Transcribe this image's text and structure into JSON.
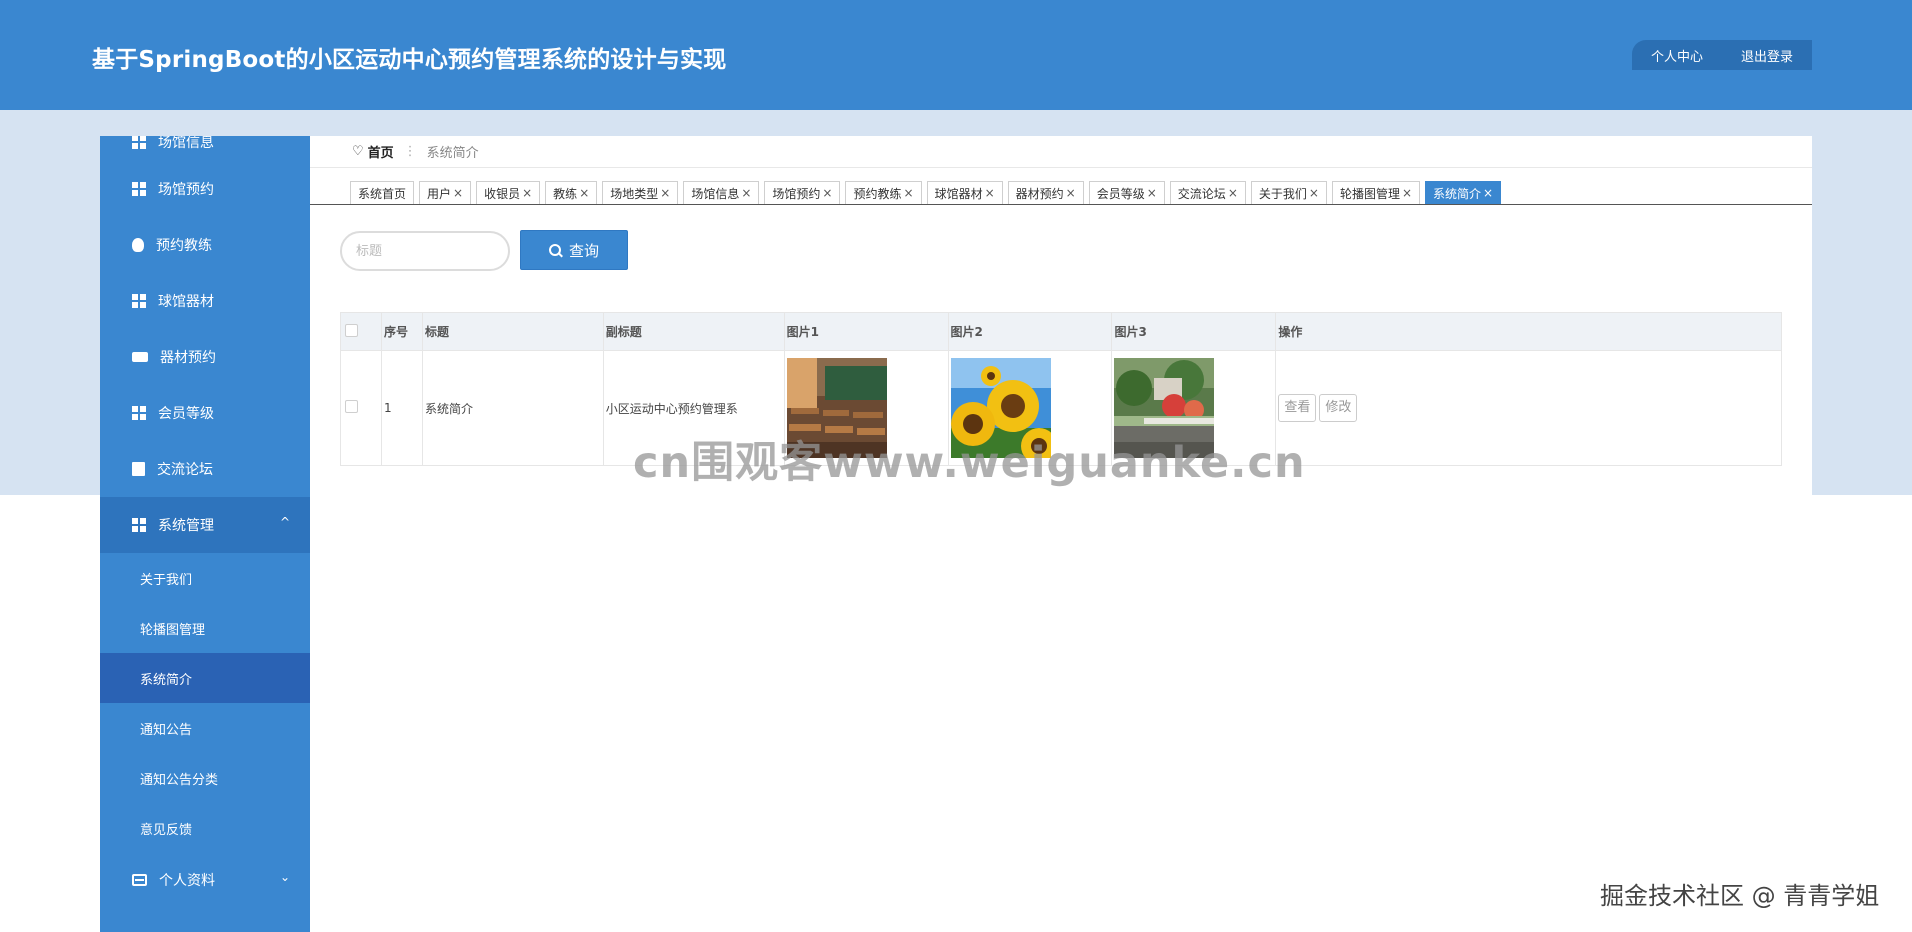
{
  "header": {
    "title": "基于SpringBoot的小区运动中心预约管理系统的设计与实现",
    "personal_center": "个人中心",
    "logout": "退出登录"
  },
  "sidebar": {
    "items": [
      {
        "label": "场馆信息",
        "icon": "grid-icon"
      },
      {
        "label": "场馆预约",
        "icon": "grid-icon"
      },
      {
        "label": "预约教练",
        "icon": "bulb-icon"
      },
      {
        "label": "球馆器材",
        "icon": "grid-icon"
      },
      {
        "label": "器材预约",
        "icon": "ticket-icon"
      },
      {
        "label": "会员等级",
        "icon": "grid-icon"
      },
      {
        "label": "交流论坛",
        "icon": "book-icon"
      },
      {
        "label": "系统管理",
        "icon": "grid-icon"
      }
    ],
    "submenu": [
      "关于我们",
      "轮播图管理",
      "系统简介",
      "通知公告",
      "通知公告分类",
      "意见反馈"
    ],
    "active_submenu": "系统简介",
    "personal": {
      "label": "个人资料",
      "icon": "card-icon"
    },
    "chevron_up": "^",
    "chevron_down": "⌄"
  },
  "breadcrumb": {
    "home": "首页",
    "separator": "⋮",
    "current": "系统简介"
  },
  "tabs": [
    {
      "label": "系统首页",
      "closable": false
    },
    {
      "label": "用户",
      "closable": true
    },
    {
      "label": "收银员",
      "closable": true
    },
    {
      "label": "教练",
      "closable": true
    },
    {
      "label": "场地类型",
      "closable": true
    },
    {
      "label": "场馆信息",
      "closable": true
    },
    {
      "label": "场馆预约",
      "closable": true
    },
    {
      "label": "预约教练",
      "closable": true
    },
    {
      "label": "球馆器材",
      "closable": true
    },
    {
      "label": "器材预约",
      "closable": true
    },
    {
      "label": "会员等级",
      "closable": true
    },
    {
      "label": "交流论坛",
      "closable": true
    },
    {
      "label": "关于我们",
      "closable": true
    },
    {
      "label": "轮播图管理",
      "closable": true
    },
    {
      "label": "系统简介",
      "closable": true,
      "active": true
    }
  ],
  "search": {
    "placeholder": "标题",
    "button_label": "查询"
  },
  "table": {
    "columns": [
      "序号",
      "标题",
      "副标题",
      "图片1",
      "图片2",
      "图片3",
      "操作"
    ],
    "rows": [
      {
        "index": "1",
        "title": "系统简介",
        "subtitle": "小区运动中心预约管理系",
        "images": [
          "classroom-photo",
          "sunflower-photo",
          "garden-photo"
        ],
        "actions": [
          "查看",
          "修改"
        ]
      }
    ]
  },
  "overlays": {
    "watermark": "cn围观客www.weiguanke.cn",
    "credit": "掘金技术社区 @ 青青学姐"
  },
  "colors": {
    "primary": "#3a87d0",
    "primary_dark": "#2a62b4",
    "band": "#d6e3f2"
  }
}
